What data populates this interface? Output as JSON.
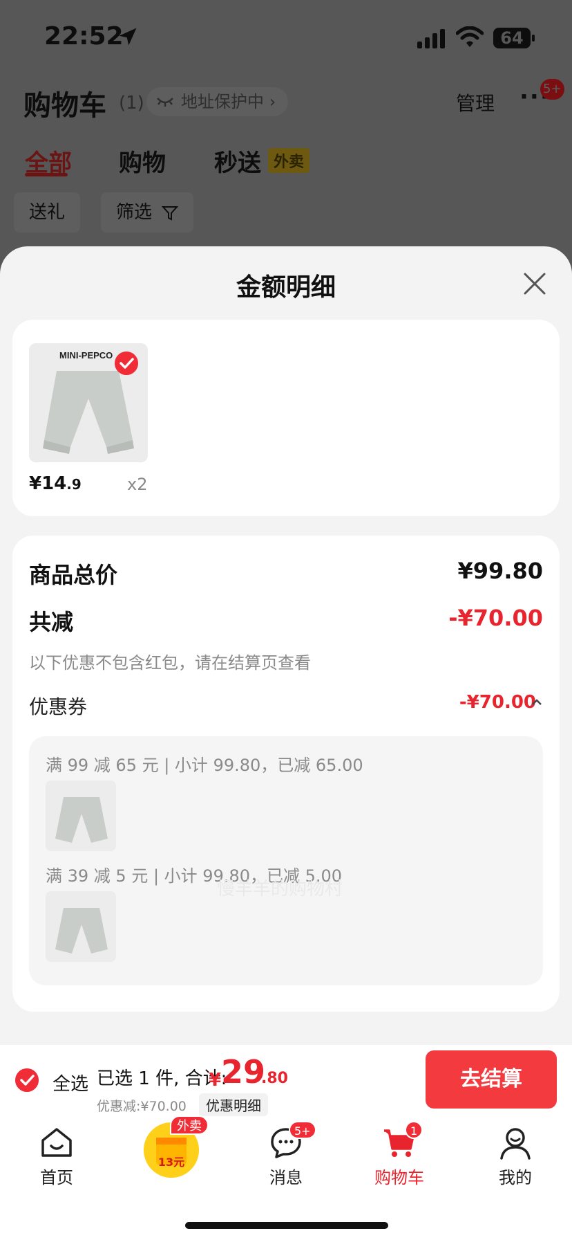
{
  "status_bar": {
    "time": "22:52",
    "battery": "64"
  },
  "cart_header": {
    "title": "购物车",
    "count": "(1)",
    "address_protect": "地址保护中",
    "manage": "管理",
    "more_badge": "5+"
  },
  "tabs": [
    {
      "label": "全部",
      "active": true
    },
    {
      "label": "购物",
      "active": false
    },
    {
      "label": "秒送",
      "active": false,
      "tag": "外卖"
    }
  ],
  "filters": {
    "gift": "送礼",
    "filter": "筛选"
  },
  "sheet": {
    "title": "金额明细",
    "product": {
      "brand": "MINI-PEPCO",
      "price_int": "¥14",
      "price_dec": ".9",
      "qty": "x2"
    },
    "total_label": "商品总价",
    "total_value": "¥99.80",
    "reduce_label": "共减",
    "reduce_value": "-¥70.00",
    "reduce_note": "以下优惠不包含红包，请在结算页查看",
    "coupon_label": "优惠券",
    "coupon_value": "-¥70.00",
    "coupon_lines": [
      "满 99 减 65 元 | 小计 99.80，已减 65.00",
      "满 39 减 5 元 | 小计 99.80，已减 5.00"
    ],
    "watermark": "慢羊羊的购物村"
  },
  "checkout": {
    "select_all": "全选",
    "summary": "已选 1 件, 合计:",
    "yen": "¥",
    "total_int": "29",
    "total_dec": ".80",
    "discount_line": "优惠减:¥70.00",
    "detail_chip": "优惠明细",
    "pay_button": "去结算"
  },
  "tabbar": {
    "home": "首页",
    "promo_tag": "外卖",
    "promo_amount": "13元",
    "messages": "消息",
    "messages_badge": "5+",
    "cart": "购物车",
    "cart_badge": "1",
    "me": "我的"
  }
}
